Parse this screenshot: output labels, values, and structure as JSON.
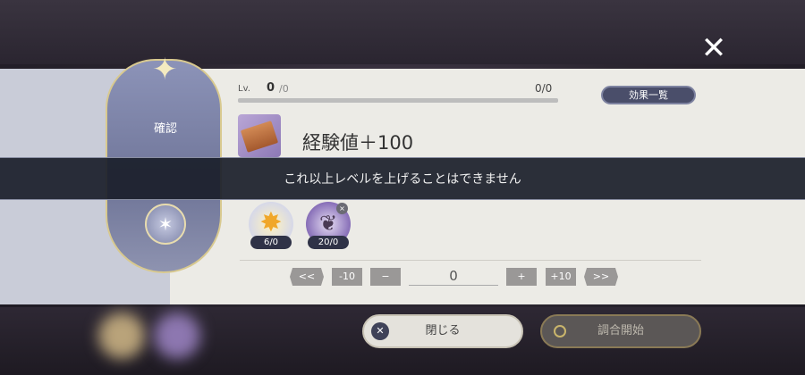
{
  "close_icon": "✕",
  "emblem": {
    "label": "確認",
    "star_icon": "✦",
    "moon_icon": "✶"
  },
  "level": {
    "label": "Lv.",
    "current": "0",
    "separator_max": "/0",
    "right": "0/0",
    "progress": 0
  },
  "effects_button": "効果一覧",
  "item": {
    "name": "経験値＋100",
    "icon": "brick-icon"
  },
  "toast": "これ以上レベルを上げることはできません",
  "materials": [
    {
      "icon": "star-burst-icon",
      "glyph": "✸",
      "count": "6/0"
    },
    {
      "icon": "branch-icon",
      "glyph": "❦",
      "count": "20/0",
      "badge": "×"
    }
  ],
  "stepper": {
    "min_label": "<<",
    "minus10_label": "-10",
    "minus1_label": "−",
    "value": "0",
    "plus1_label": "+",
    "plus10_label": "+10",
    "max_label": ">>"
  },
  "buttons": {
    "close_label": "閉じる",
    "close_icon": "✕",
    "start_label": "調合開始"
  },
  "colors": {
    "panel": "#ecebe6",
    "accent_dark": "#2f3247",
    "toast_bg": "#1a1e2a"
  }
}
